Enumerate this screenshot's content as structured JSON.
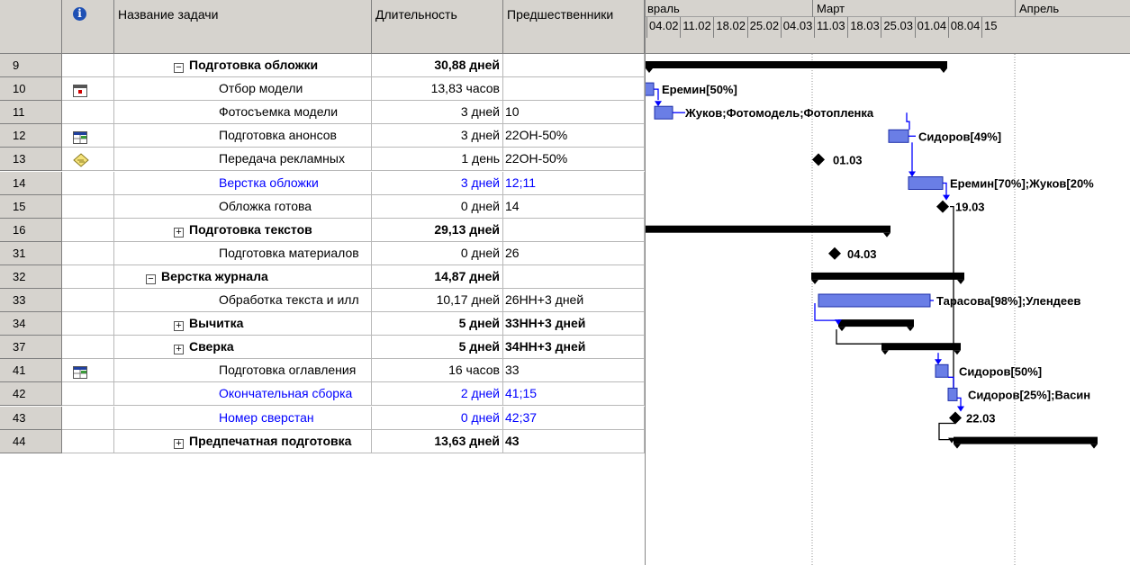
{
  "columns": {
    "id": "",
    "indicators": "i",
    "name": "Название задачи",
    "duration": "Длительность",
    "predecessors": "Предшественники"
  },
  "timescale": {
    "months": [
      "враль",
      "Март",
      "Апрель"
    ],
    "weeks": [
      "04.02",
      "11.02",
      "18.02",
      "25.02",
      "04.03",
      "11.03",
      "18.03",
      "25.03",
      "01.04",
      "08.04",
      "15"
    ]
  },
  "rows": [
    {
      "id": "9",
      "indicator": "",
      "name": "Подготовка обложки",
      "duration": "30,88 дней",
      "pred": "",
      "level": 1,
      "summary": true,
      "expander": "−",
      "color": "black"
    },
    {
      "id": "10",
      "indicator": "calendar-red",
      "name": "Отбор модели",
      "duration": "13,83 часов",
      "pred": "",
      "level": 2,
      "summary": false,
      "expander": "",
      "color": "black"
    },
    {
      "id": "11",
      "indicator": "",
      "name": "Фотосъемка модели",
      "duration": "3 дней",
      "pred": "10",
      "level": 2,
      "summary": false,
      "expander": "",
      "color": "black"
    },
    {
      "id": "12",
      "indicator": "table",
      "name": "Подготовка анонсов",
      "duration": "3 дней",
      "pred": "22ОН-50%",
      "level": 2,
      "summary": false,
      "expander": "",
      "color": "black"
    },
    {
      "id": "13",
      "indicator": "note",
      "name": "Передача рекламных",
      "duration": "1 день",
      "pred": "22ОН-50%",
      "level": 2,
      "summary": false,
      "expander": "",
      "color": "black"
    },
    {
      "id": "14",
      "indicator": "",
      "name": "Верстка обложки",
      "duration": "3 дней",
      "pred": "12;11",
      "level": 2,
      "summary": false,
      "expander": "",
      "color": "blue"
    },
    {
      "id": "15",
      "indicator": "",
      "name": "Обложка готова",
      "duration": "0 дней",
      "pred": "14",
      "level": 2,
      "summary": false,
      "expander": "",
      "color": "black"
    },
    {
      "id": "16",
      "indicator": "",
      "name": "Подготовка текстов",
      "duration": "29,13 дней",
      "pred": "",
      "level": 1,
      "summary": true,
      "expander": "+",
      "color": "black"
    },
    {
      "id": "31",
      "indicator": "",
      "name": "Подготовка материалов",
      "duration": "0 дней",
      "pred": "26",
      "level": 2,
      "summary": false,
      "expander": "",
      "color": "black"
    },
    {
      "id": "32",
      "indicator": "",
      "name": "Верстка журнала",
      "duration": "14,87 дней",
      "pred": "",
      "level": 0,
      "summary": true,
      "expander": "−",
      "color": "black"
    },
    {
      "id": "33",
      "indicator": "",
      "name": "Обработка текста и илл",
      "duration": "10,17 дней",
      "pred": "26НН+3 дней",
      "level": 2,
      "summary": false,
      "expander": "",
      "color": "black"
    },
    {
      "id": "34",
      "indicator": "",
      "name": "Вычитка",
      "duration": "5 дней",
      "pred": "33НН+3 дней",
      "level": 1,
      "summary": true,
      "expander": "+",
      "color": "black"
    },
    {
      "id": "37",
      "indicator": "",
      "name": "Сверка",
      "duration": "5 дней",
      "pred": "34НН+3 дней",
      "level": 1,
      "summary": true,
      "expander": "+",
      "color": "black"
    },
    {
      "id": "41",
      "indicator": "table",
      "name": "Подготовка оглавления",
      "duration": "16 часов",
      "pred": "33",
      "level": 2,
      "summary": false,
      "expander": "",
      "color": "black"
    },
    {
      "id": "42",
      "indicator": "",
      "name": "Окончательная сборка",
      "duration": "2 дней",
      "pred": "41;15",
      "level": 2,
      "summary": false,
      "expander": "",
      "color": "blue"
    },
    {
      "id": "43",
      "indicator": "",
      "name": "Номер сверстан",
      "duration": "0 дней",
      "pred": "42;37",
      "level": 2,
      "summary": false,
      "expander": "",
      "color": "blue"
    },
    {
      "id": "44",
      "indicator": "",
      "name": "Предпечатная подготовка",
      "duration": "13,63 дней",
      "pred": "43",
      "level": 1,
      "summary": true,
      "expander": "+",
      "color": "black"
    }
  ],
  "gantt_labels": {
    "r10": "Еремин[50%]",
    "r11": "Жуков;Фотомодель;Фотопленка",
    "r12": "Сидоров[49%]",
    "r13": "01.03",
    "r14": "Еремин[70%];Жуков[20%",
    "r15": "19.03",
    "r31": "04.03",
    "r33": "Тарасова[98%];Улендеев",
    "r41": "Сидоров[50%]",
    "r42": "Сидоров[25%];Васин",
    "r43": "22.03"
  },
  "colors": {
    "header_bg": "#d6d3ce",
    "task_bar": "#5a6fe0",
    "link": "#0000ff",
    "summary": "#000000"
  }
}
